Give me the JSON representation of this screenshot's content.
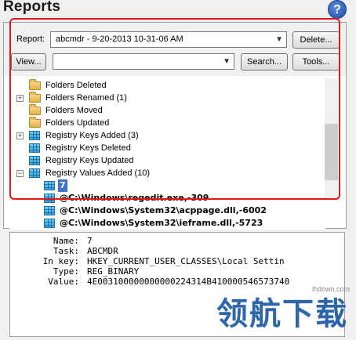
{
  "window": {
    "title": "Reports"
  },
  "controls": {
    "report_label": "Report:",
    "report_value": "abcmdr - 9-20-2013 10-31-06 AM",
    "delete_label": "Delete...",
    "view_label": "View...",
    "search_value": "",
    "search_label": "Search...",
    "tools_label": "Tools..."
  },
  "tree": {
    "items": [
      {
        "label": "Folders Deleted",
        "icon": "folder-icon",
        "expander": ""
      },
      {
        "label": "Folders Renamed (1)",
        "icon": "folder-icon",
        "expander": "+"
      },
      {
        "label": "Folders Moved",
        "icon": "folder-icon",
        "expander": ""
      },
      {
        "label": "Folders Updated",
        "icon": "folder-icon",
        "expander": ""
      },
      {
        "label": "Registry Keys Added (3)",
        "icon": "registry-icon",
        "expander": "+"
      },
      {
        "label": "Registry Keys Deleted",
        "icon": "registry-icon",
        "expander": ""
      },
      {
        "label": "Registry Keys Updated",
        "icon": "registry-icon",
        "expander": ""
      },
      {
        "label": "Registry Values Added (10)",
        "icon": "registry-icon",
        "expander": "−"
      }
    ],
    "values": [
      {
        "label": "7",
        "selected": true
      },
      {
        "label": "@C:\\Windows\\regedit.exe,-309"
      },
      {
        "label": "@C:\\Windows\\System32\\acppage.dll,-6002"
      },
      {
        "label": "@C:\\Windows\\System32\\ieframe.dll,-5723"
      }
    ]
  },
  "details": {
    "rows": [
      {
        "key": "Name:",
        "value": "7"
      },
      {
        "key": "Task:",
        "value": "ABCMDR"
      },
      {
        "key": "In key:",
        "value": "HKEY_CURRENT_USER_CLASSES\\Local Settin"
      },
      {
        "key": "Type:",
        "value": "REG_BINARY"
      },
      {
        "key": "Value:",
        "value": "4E003100000000000224314B410000546573740"
      }
    ]
  },
  "watermark": {
    "site": "lhdown.com",
    "text": "领航下载"
  },
  "colors": {
    "highlight": "#e01818",
    "selection": "#3d74c8",
    "watermark": "#1d5aa8"
  }
}
